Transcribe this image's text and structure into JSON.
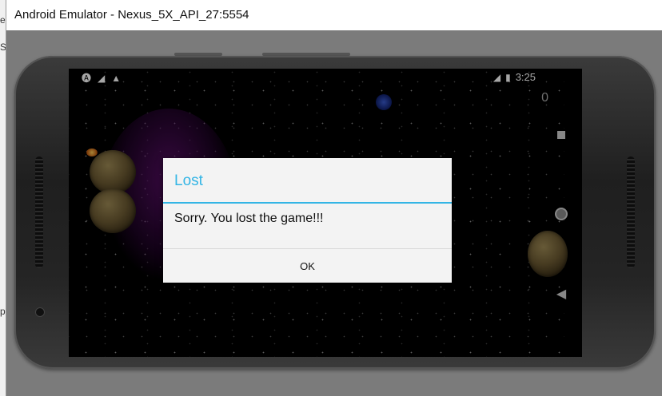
{
  "window": {
    "title": "Android Emulator - Nexus_5X_API_27:5554"
  },
  "left_strip": {
    "chars": [
      "e",
      "S",
      "p"
    ]
  },
  "status_bar": {
    "left_icons": [
      "notification-a-icon",
      "no-signal-icon",
      "warning-icon"
    ],
    "right_icons": [
      "lte-signal-icon",
      "battery-charging-icon"
    ],
    "time": "3:25"
  },
  "game": {
    "score": "0"
  },
  "nav_bar": {
    "buttons": [
      "recents-square-icon",
      "home-circle-icon",
      "back-triangle-icon"
    ]
  },
  "dialog": {
    "title": "Lost",
    "message": "Sorry. You lost the game!!!",
    "ok_label": "OK"
  },
  "colors": {
    "dialog_accent": "#33b5e5"
  }
}
